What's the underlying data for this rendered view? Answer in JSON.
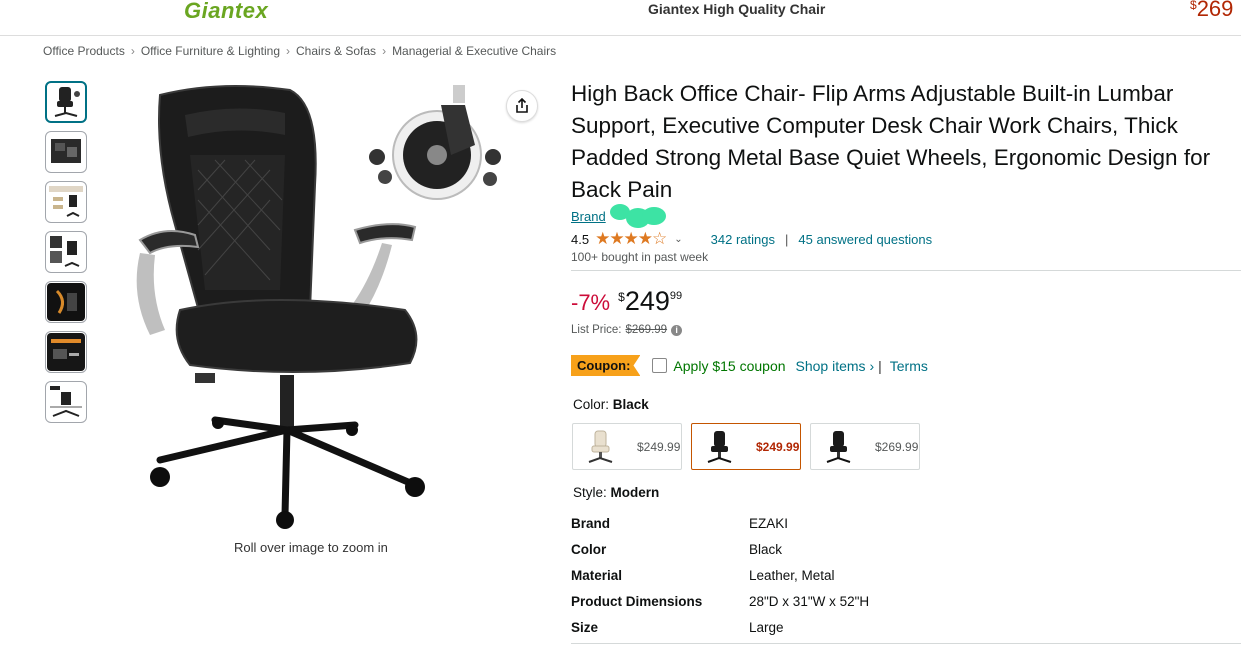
{
  "header": {
    "logo": "Giantex",
    "title": "Giantex High Quality Chair",
    "price_currency": "$",
    "price": "269"
  },
  "breadcrumb": [
    "Office Products",
    "Office Furniture & Lighting",
    "Chairs & Sofas",
    "Managerial & Executive Chairs"
  ],
  "breadcrumb_separator": "›",
  "gallery": {
    "thumbnail_count": 7,
    "zoom_hint": "Roll over image to zoom in"
  },
  "product": {
    "title": "High Back Office Chair- Flip Arms Adjustable Built-in Lumbar Support, Executive Computer Desk Chair Work Chairs, Thick Padded Strong Metal Base Quiet Wheels, Ergonomic Design for Back Pain",
    "brand_link": "Brand",
    "rating": "4.5",
    "stars": "★★★★☆",
    "ratings_count": "342 ratings",
    "answered": "45 answered questions",
    "bought": "100+ bought in past week"
  },
  "pricing": {
    "discount": "-7%",
    "currency": "$",
    "whole": "249",
    "fraction": "99",
    "list_label": "List Price:",
    "list_price": "$269.99"
  },
  "coupon": {
    "badge": "Coupon:",
    "apply": "Apply $15 coupon",
    "shop_items": "Shop items ›",
    "pipe": "|",
    "terms": "Terms",
    "checked": false
  },
  "color": {
    "label": "Color:",
    "value": "Black",
    "options": [
      {
        "price": "$249.99",
        "tone": "#e9e0cf",
        "selected": false
      },
      {
        "price": "$249.99",
        "tone": "#1a1a1a",
        "selected": true
      },
      {
        "price": "$269.99",
        "tone": "#1a1a1a",
        "selected": false
      }
    ]
  },
  "style": {
    "label": "Style:",
    "value": "Modern"
  },
  "specs": [
    {
      "key": "Brand",
      "value": "EZAKI"
    },
    {
      "key": "Color",
      "value": "Black"
    },
    {
      "key": "Material",
      "value": "Leather, Metal"
    },
    {
      "key": "Product Dimensions",
      "value": "28\"D x 31\"W x 52\"H"
    },
    {
      "key": "Size",
      "value": "Large"
    }
  ],
  "colors": {
    "link": "#007185",
    "price_red": "#b12704",
    "discount_red": "#cc0c39",
    "star": "#de7921",
    "coupon_badge": "#f7a11a",
    "logo_green": "#6aa621",
    "brand_blob": "#3de3a4"
  }
}
